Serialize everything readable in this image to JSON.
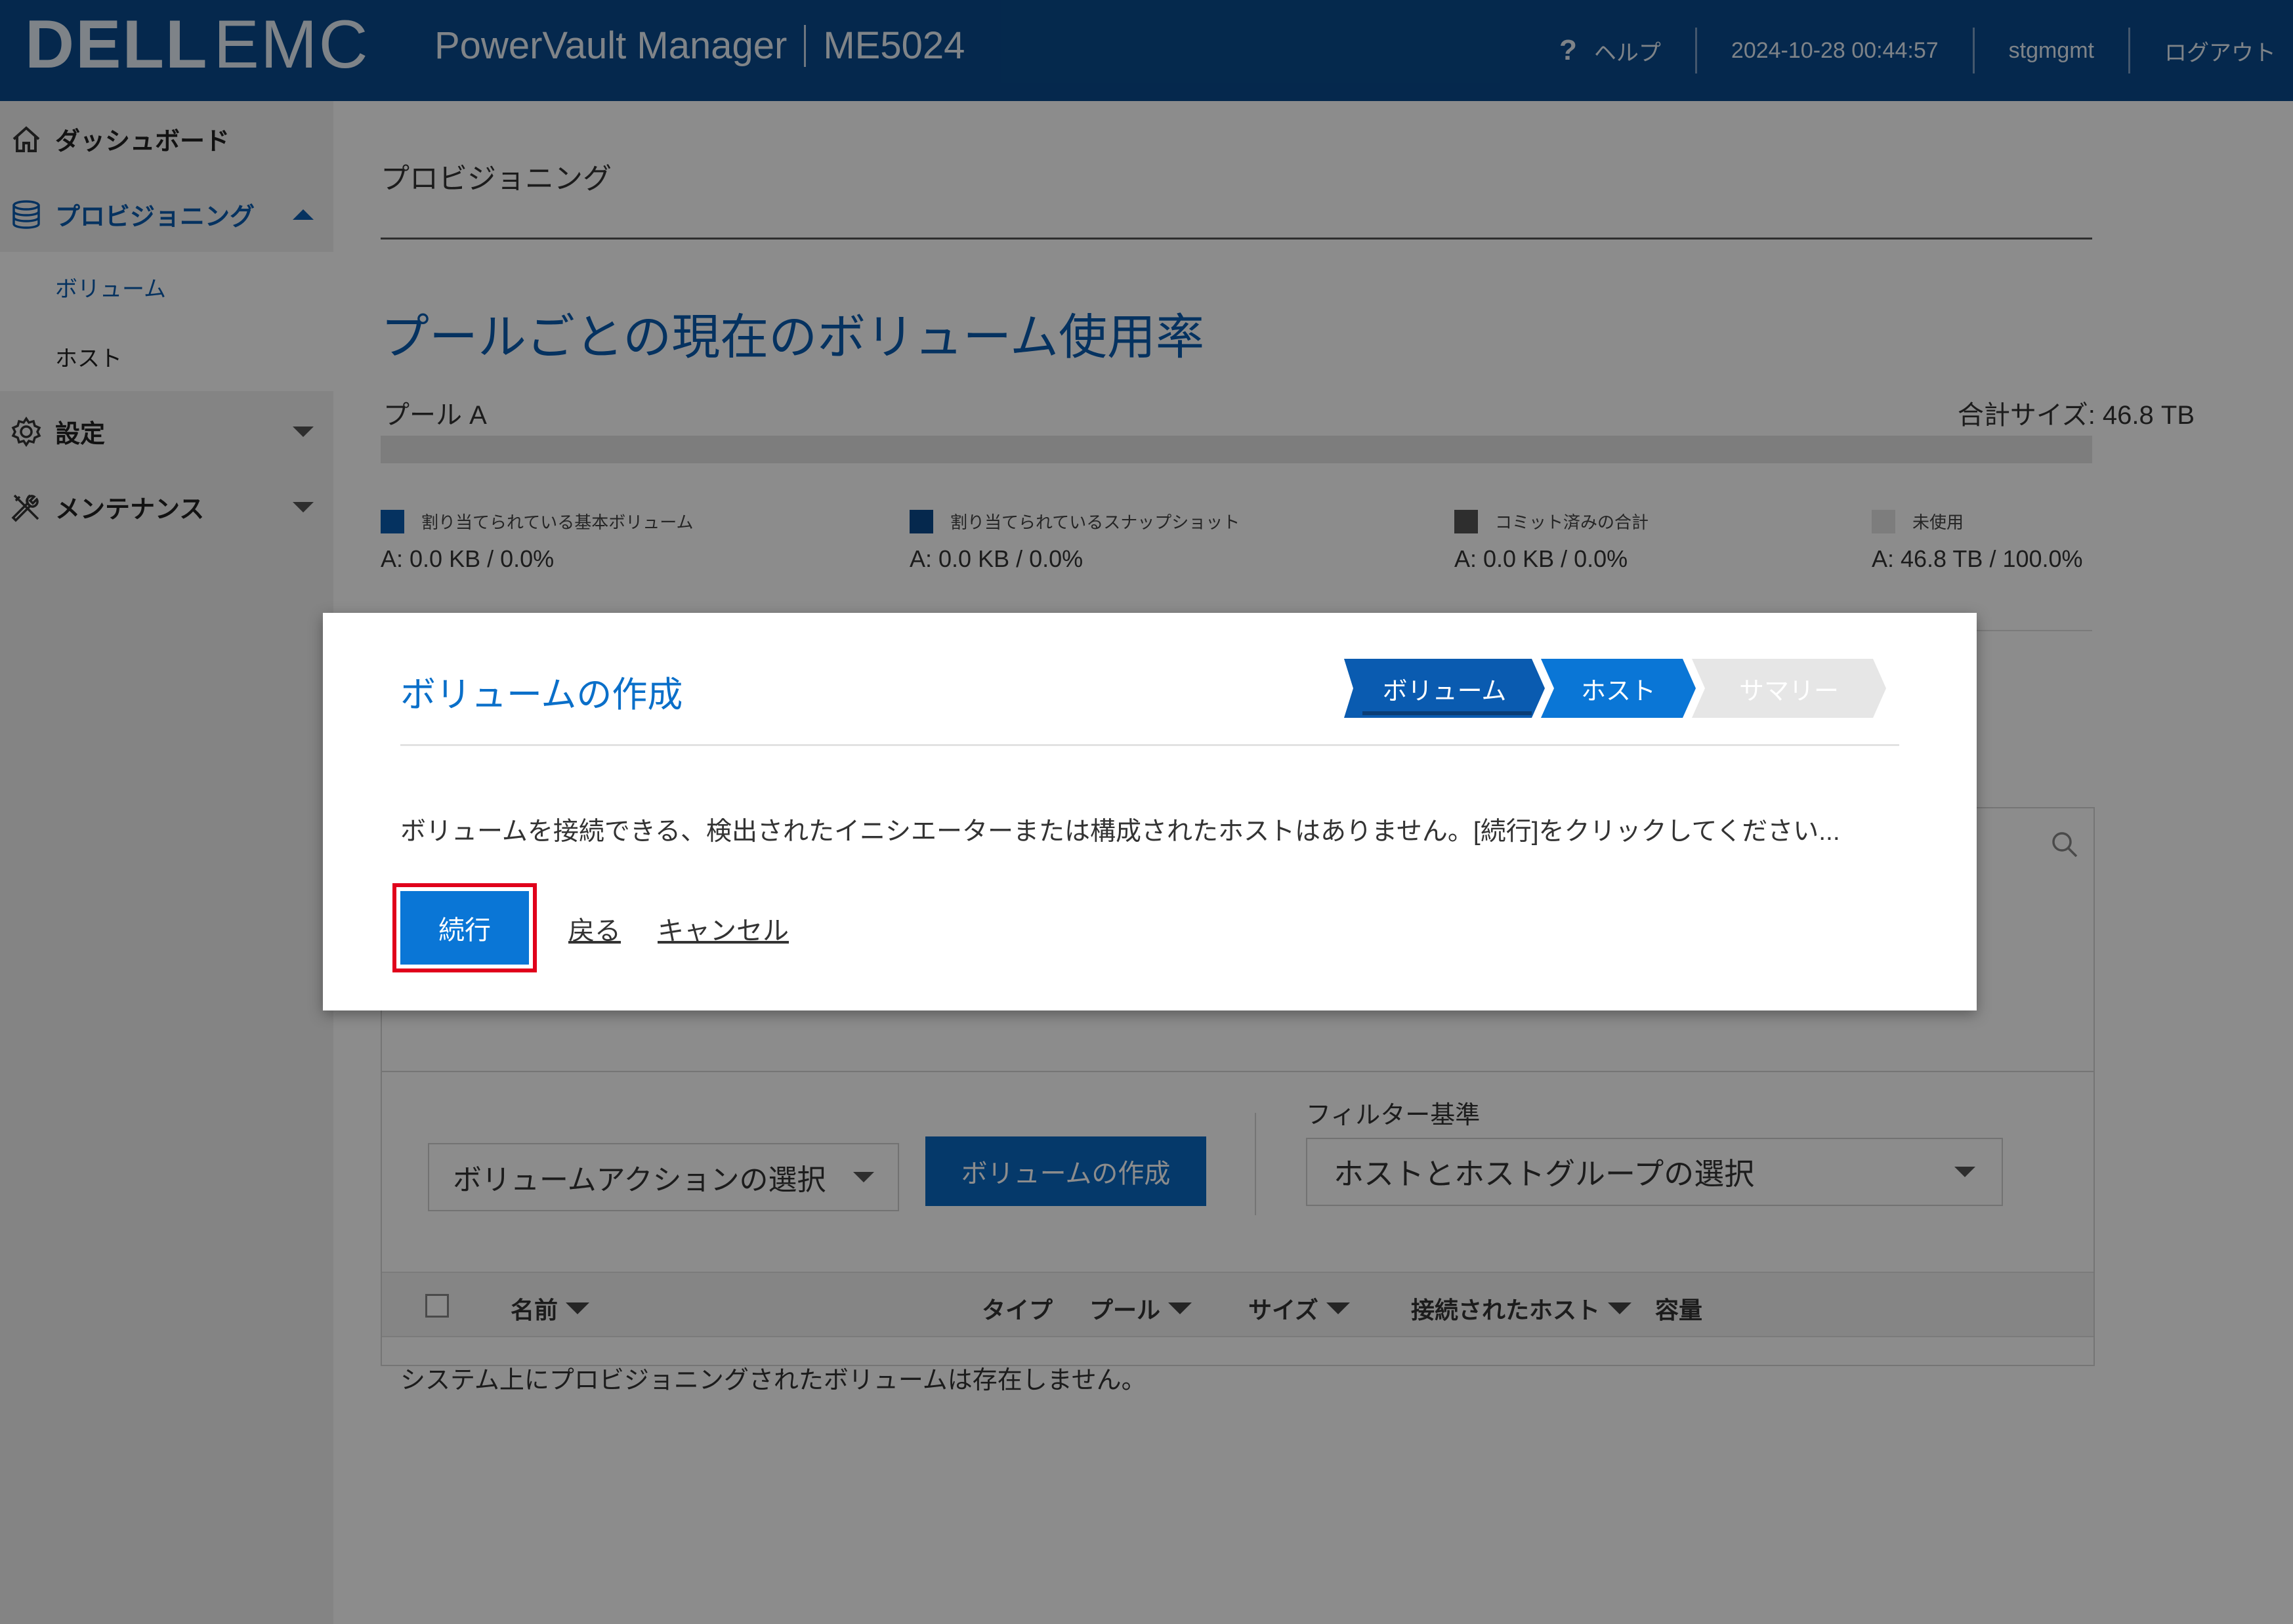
{
  "header": {
    "logo_left": "DELL",
    "logo_right": "EMC",
    "product": "PowerVault Manager",
    "model": "ME5024",
    "help_icon": "?",
    "help": "ヘルプ",
    "datetime": "2024-10-28 00:44:57",
    "user": "stgmgmt",
    "logout": "ログアウト",
    "bg_color": "#0a4a8c"
  },
  "sidebar": {
    "items": [
      {
        "label": "ダッシュボード",
        "icon": "home-icon"
      },
      {
        "label": "プロビジョニング",
        "icon": "database-icon",
        "expanded": true
      },
      {
        "label": "ボリューム",
        "sub": true,
        "active": true
      },
      {
        "label": "ホスト",
        "sub": true
      },
      {
        "label": "設定",
        "icon": "gear-icon"
      },
      {
        "label": "メンテナンス",
        "icon": "tools-icon"
      }
    ]
  },
  "main": {
    "breadcrumb": "プロビジョニング",
    "pool_section_title": "プールごとの現在のボリューム使用率",
    "pool_name": "プール A",
    "pool_total": "合計サイズ: 46.8 TB",
    "legend": [
      {
        "label": "割り当てられている基本ボリューム",
        "value": "A: 0.0 KB / 0.0%",
        "color": "#0a5bb0"
      },
      {
        "label": "割り当てられているスナップショット",
        "value": "A: 0.0 KB / 0.0%",
        "color": "#0a4a8c"
      },
      {
        "label": "コミット済みの合計",
        "value": "A: 0.0 KB / 0.0%",
        "color": "#555555"
      },
      {
        "label": "未使用",
        "value": "A: 46.8 TB / 100.0%",
        "color": "#e4e4e4"
      }
    ],
    "volume_actions": "ボリュームアクションの選択",
    "create_volume": "ボリュームの作成",
    "filter_label": "フィルター基準",
    "filter_value": "ホストとホストグループの選択",
    "columns": [
      "名前",
      "タイプ",
      "プール",
      "サイズ",
      "接続されたホスト",
      "容量"
    ],
    "empty_message": "システム上にプロビジョニングされたボリュームは存在しません。"
  },
  "modal": {
    "title": "ボリュームの作成",
    "steps": [
      {
        "label": "ボリューム",
        "state": "done"
      },
      {
        "label": "ホスト",
        "state": "current"
      },
      {
        "label": "サマリー",
        "state": "pending"
      }
    ],
    "message": "ボリュームを接続できる、検出されたイニシエーターまたは構成されたホストはありません。[続行]をクリックしてください...",
    "continue": "続行",
    "back": "戻る",
    "cancel": "キャンセル",
    "highlight_color": "#e0001b"
  }
}
